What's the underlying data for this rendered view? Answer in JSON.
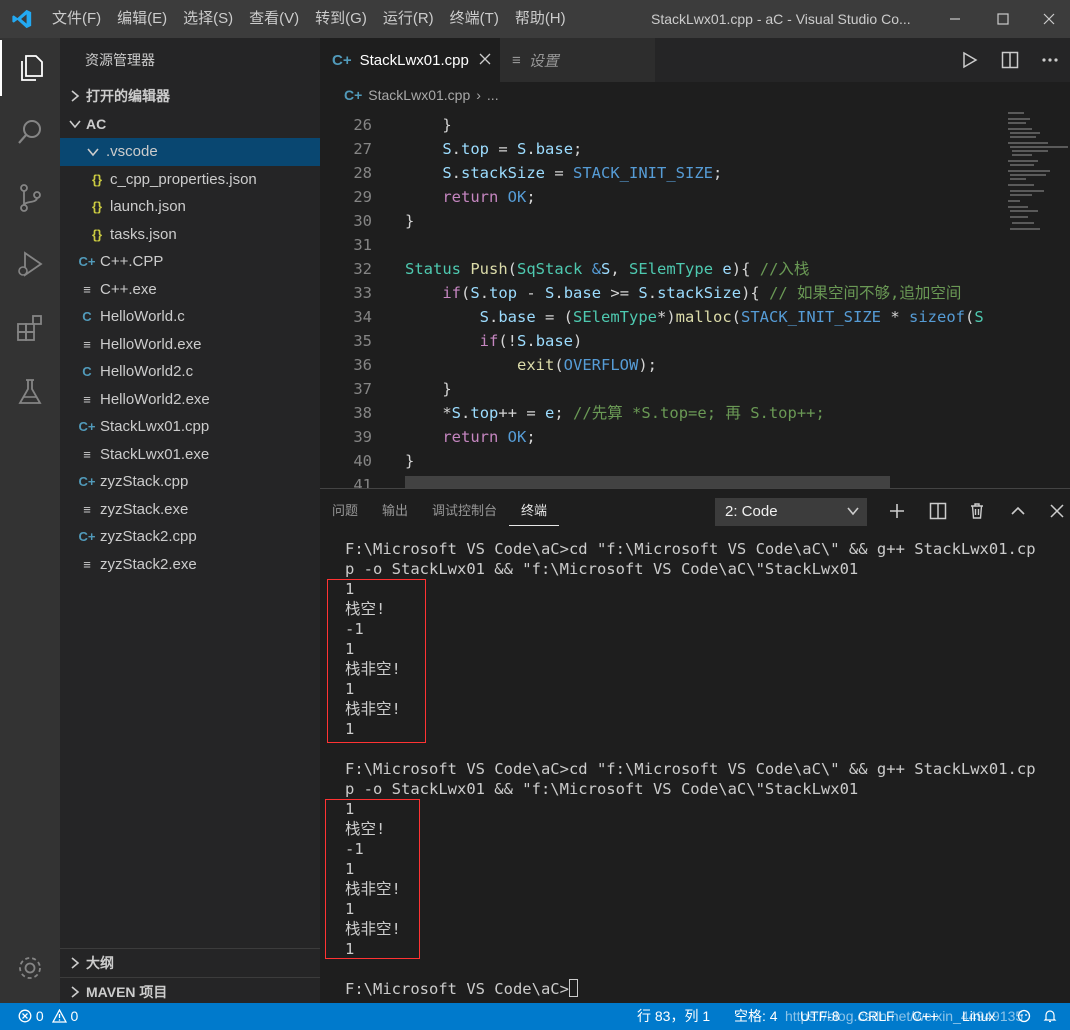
{
  "titlebar": {
    "menu": [
      "文件(F)",
      "编辑(E)",
      "选择(S)",
      "查看(V)",
      "转到(G)",
      "运行(R)",
      "终端(T)",
      "帮助(H)"
    ],
    "title": "StackLwx01.cpp - aC - Visual Studio Co..."
  },
  "sidebar": {
    "title": "资源管理器",
    "open_editors": "打开的编辑器",
    "root": "AC",
    "items": [
      {
        "label": ".vscode",
        "icon": "chevron-down-icon"
      },
      {
        "label": "c_cpp_properties.json",
        "icon": "json-icon"
      },
      {
        "label": "launch.json",
        "icon": "json-icon"
      },
      {
        "label": "tasks.json",
        "icon": "json-icon"
      },
      {
        "label": "C++.CPP",
        "icon": "cpp-icon"
      },
      {
        "label": "C++.exe",
        "icon": "file-icon"
      },
      {
        "label": "HelloWorld.c",
        "icon": "c-icon"
      },
      {
        "label": "HelloWorld.exe",
        "icon": "file-icon"
      },
      {
        "label": "HelloWorld2.c",
        "icon": "c-icon"
      },
      {
        "label": "HelloWorld2.exe",
        "icon": "file-icon"
      },
      {
        "label": "StackLwx01.cpp",
        "icon": "cpp-icon"
      },
      {
        "label": "StackLwx01.exe",
        "icon": "file-icon"
      },
      {
        "label": "zyzStack.cpp",
        "icon": "cpp-icon"
      },
      {
        "label": "zyzStack.exe",
        "icon": "file-icon"
      },
      {
        "label": "zyzStack2.cpp",
        "icon": "cpp-icon"
      },
      {
        "label": "zyzStack2.exe",
        "icon": "file-icon"
      }
    ],
    "outline": "大纲",
    "maven": "MAVEN 项目"
  },
  "tabs": {
    "active": "StackLwx01.cpp",
    "settings": "设置"
  },
  "breadcrumb": {
    "file": "StackLwx01.cpp",
    "more": "..."
  },
  "code": {
    "line_numbers": [
      "26",
      "27",
      "28",
      "29",
      "30",
      "31",
      "32",
      "33",
      "34",
      "35",
      "36",
      "37",
      "38",
      "39",
      "40",
      "41"
    ],
    "comment_push": "//入栈",
    "comment_if": "// 如果空间不够,追加空间",
    "comment_inc": "//先算 *S.top=e; 再 S.top++;"
  },
  "panel": {
    "tabs": [
      "问题",
      "输出",
      "调试控制台",
      "终端"
    ],
    "active_tab": "终端",
    "terminal_select": "2: Code"
  },
  "terminal": {
    "lines": [
      "F:\\Microsoft VS Code\\aC>cd \"f:\\Microsoft VS Code\\aC\\\" && g++ StackLwx01.cp",
      "p -o StackLwx01 && \"f:\\Microsoft VS Code\\aC\\\"StackLwx01",
      "1",
      "栈空!",
      "-1",
      "1",
      "栈非空!",
      "1",
      "栈非空!",
      "1",
      "",
      "F:\\Microsoft VS Code\\aC>cd \"f:\\Microsoft VS Code\\aC\\\" && g++ StackLwx01.cp",
      "p -o StackLwx01 && \"f:\\Microsoft VS Code\\aC\\\"StackLwx01",
      "1",
      "栈空!",
      "-1",
      "1",
      "栈非空!",
      "1",
      "栈非空!",
      "1",
      "",
      "F:\\Microsoft VS Code\\aC>"
    ]
  },
  "statusbar": {
    "errors": "0",
    "warnings": "0",
    "position": "行 83，列 1",
    "spaces": "空格: 4",
    "encoding": "UTF-8",
    "eol": "CRLF",
    "language": "C++",
    "os": "Linux",
    "watermark": "https://blog.csdn.net/weixin_44949135"
  },
  "colors": {
    "accent": "#007acc",
    "selection": "#094771",
    "highlight_box": "#ff3333"
  }
}
